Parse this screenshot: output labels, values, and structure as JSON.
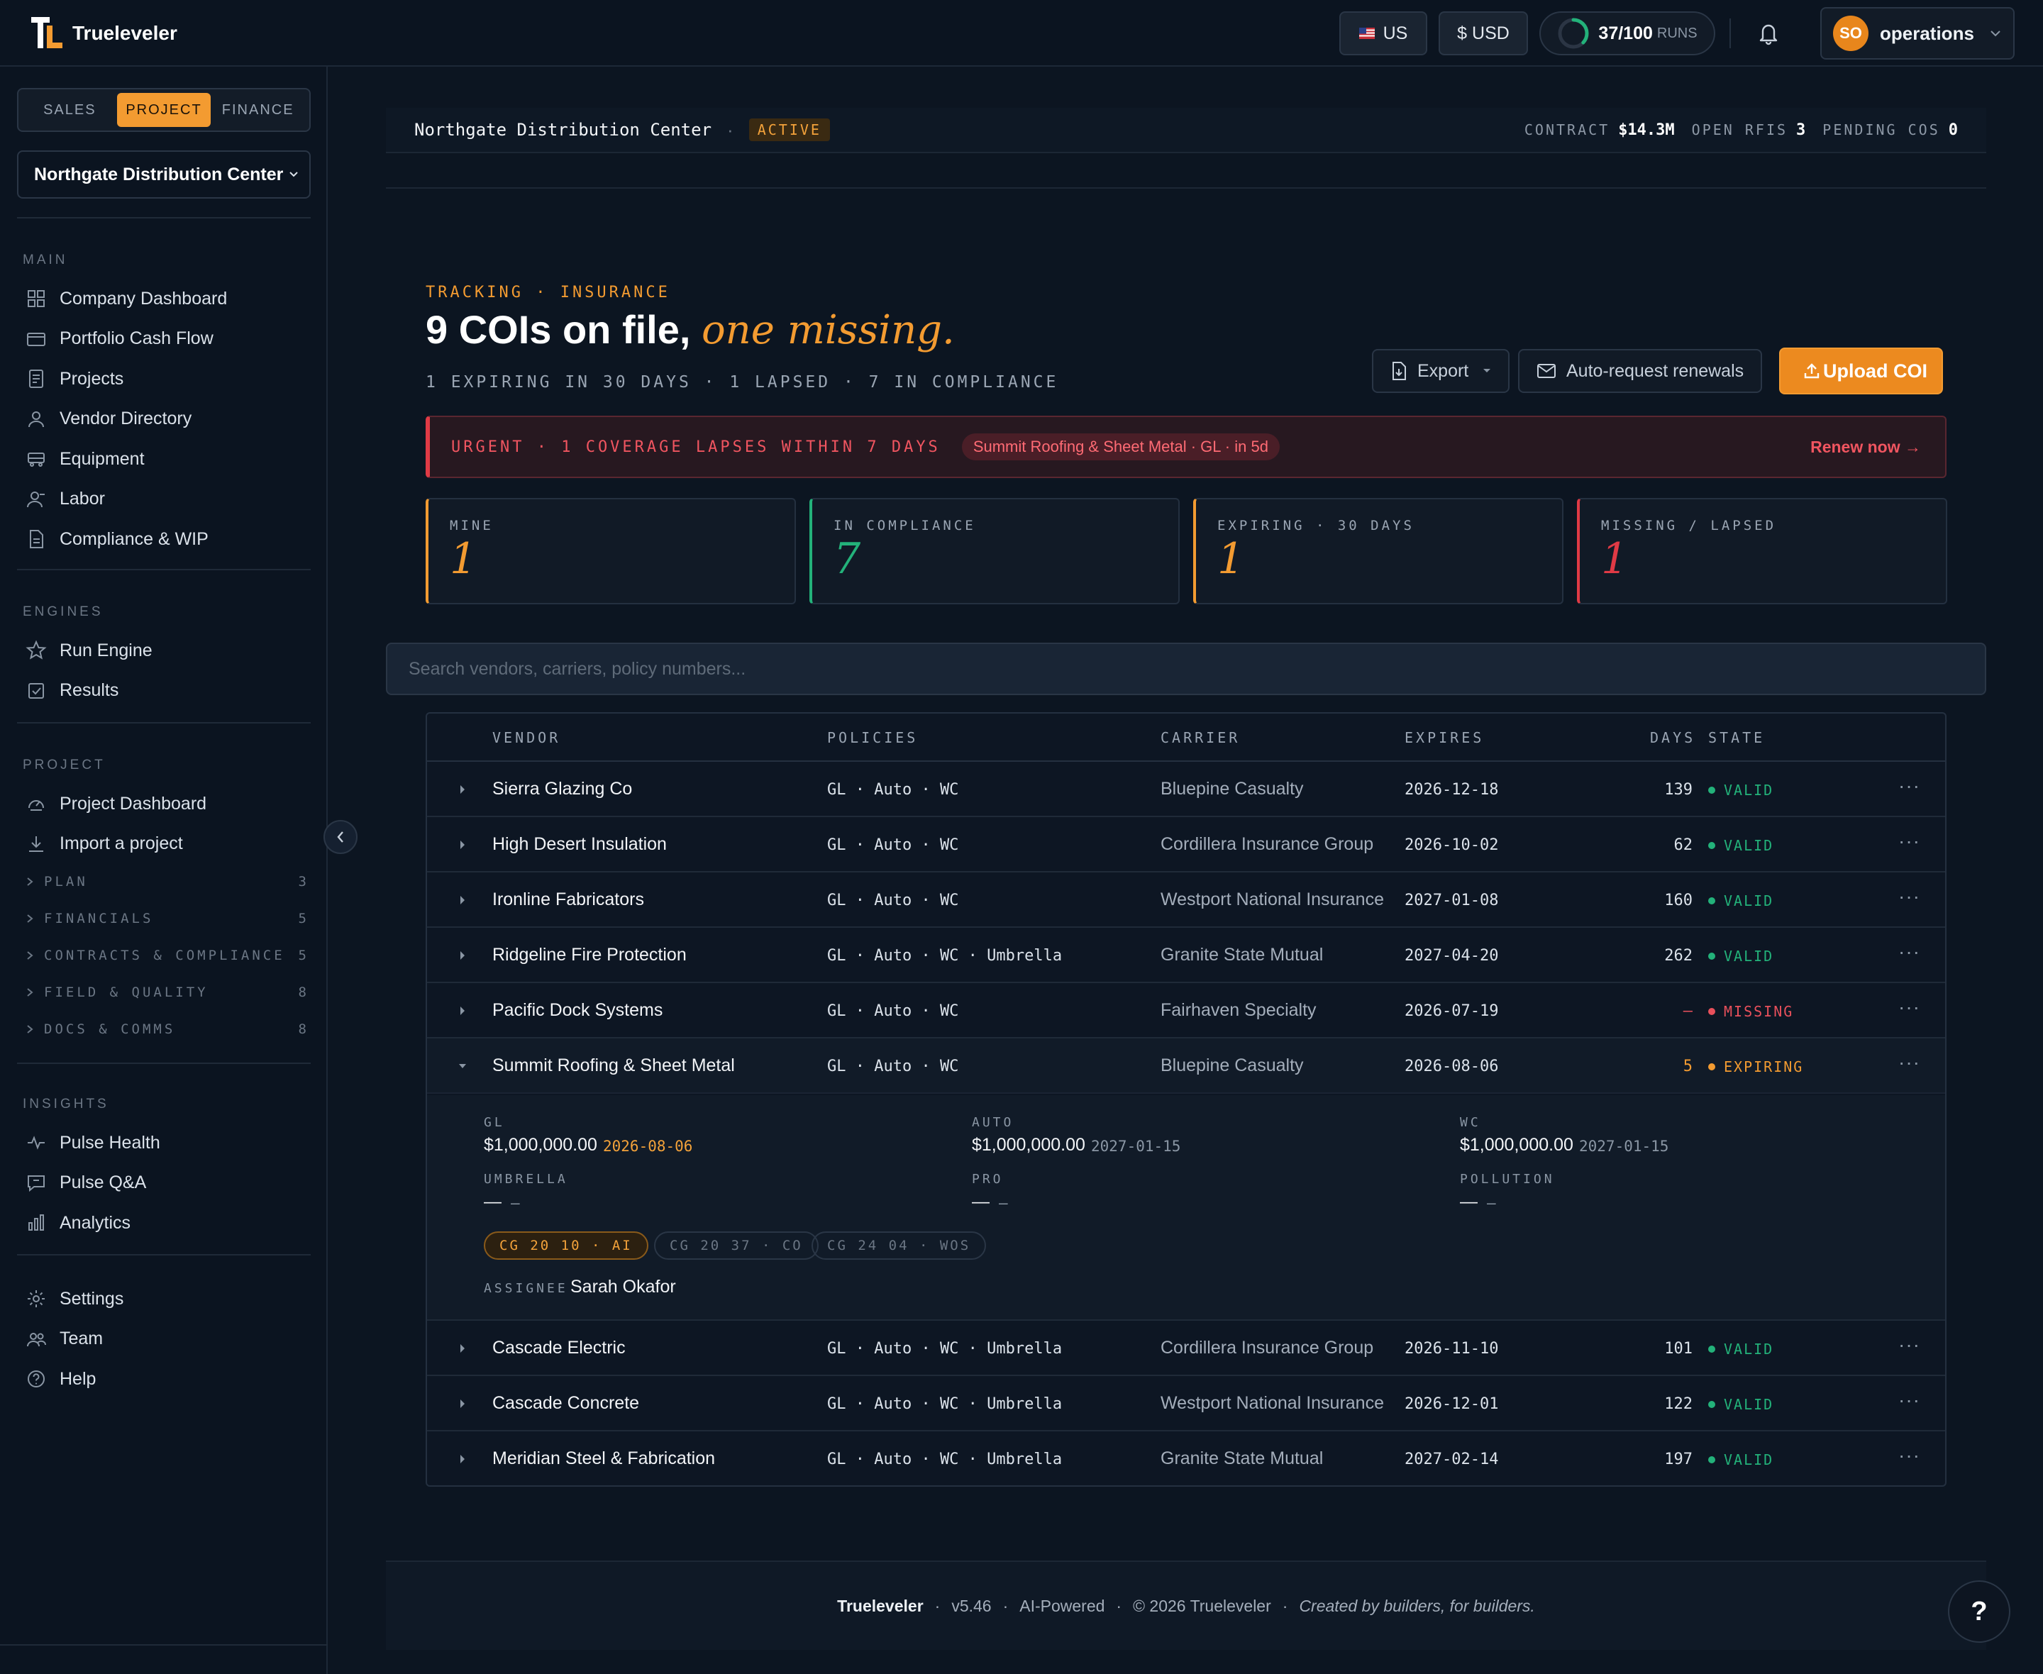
{
  "app": {
    "name": "Trueleveler"
  },
  "topbar": {
    "region": "US",
    "currency": "$ USD",
    "runs_used": "37/100",
    "runs_unit": "RUNS",
    "runs_fraction": 0.37,
    "user_initials": "SO",
    "user_name": "operations"
  },
  "sidebar": {
    "tabs": [
      "SALES",
      "PROJECT",
      "FINANCE"
    ],
    "active_tab": "PROJECT",
    "project": "Northgate Distribution Center",
    "main_heading": "MAIN",
    "main_items": [
      {
        "label": "Company Dashboard",
        "icon": "grid-icon"
      },
      {
        "label": "Portfolio Cash Flow",
        "icon": "wallet-icon"
      },
      {
        "label": "Projects",
        "icon": "document-icon"
      },
      {
        "label": "Vendor Directory",
        "icon": "person-icon"
      },
      {
        "label": "Equipment",
        "icon": "truck-icon"
      },
      {
        "label": "Labor",
        "icon": "worker-icon"
      },
      {
        "label": "Compliance & WIP",
        "icon": "file-icon"
      }
    ],
    "engines_heading": "ENGINES",
    "engine_items": [
      {
        "label": "Run Engine",
        "icon": "star-icon"
      },
      {
        "label": "Results",
        "icon": "checkbox-icon"
      }
    ],
    "project_heading": "PROJECT",
    "project_items": [
      {
        "label": "Project Dashboard",
        "icon": "gauge-icon"
      },
      {
        "label": "Import a project",
        "icon": "download-icon"
      }
    ],
    "groups": [
      {
        "label": "PLAN",
        "count": "3"
      },
      {
        "label": "FINANCIALS",
        "count": "5"
      },
      {
        "label": "CONTRACTS & COMPLIANCE",
        "count": "5"
      },
      {
        "label": "FIELD & QUALITY",
        "count": "8"
      },
      {
        "label": "DOCS & COMMS",
        "count": "8"
      }
    ],
    "insights_heading": "INSIGHTS",
    "insight_items": [
      {
        "label": "Pulse Health",
        "icon": "pulse-icon"
      },
      {
        "label": "Pulse Q&A",
        "icon": "chat-icon"
      },
      {
        "label": "Analytics",
        "icon": "bar-chart-icon"
      }
    ],
    "bottom_items": [
      {
        "label": "Settings",
        "icon": "gear-icon"
      },
      {
        "label": "Team",
        "icon": "team-icon"
      },
      {
        "label": "Help",
        "icon": "help-icon"
      }
    ]
  },
  "strip": {
    "project": "Northgate Distribution Center",
    "status": "ACTIVE",
    "contract_label": "CONTRACT",
    "contract_value": "$14.3M",
    "rfis_label": "OPEN RFIS",
    "rfis_value": "3",
    "cos_label": "PENDING COS",
    "cos_value": "0"
  },
  "header": {
    "eyebrow": "TRACKING · INSURANCE",
    "title_main": "9 COIs on file,",
    "title_accent": "one missing.",
    "subline": "1 EXPIRING IN 30 DAYS · 1 LAPSED · 7 IN COMPLIANCE",
    "export_label": "Export",
    "auto_label": "Auto-request renewals",
    "upload_label": "Upload COI"
  },
  "alert": {
    "text": "URGENT · 1 COVERAGE LAPSES WITHIN 7 DAYS",
    "chip": "Summit Roofing & Sheet Metal · GL · in 5d",
    "link": "Renew now →"
  },
  "cards": [
    {
      "label": "MINE",
      "value": "1",
      "color": "#f39b31"
    },
    {
      "label": "IN COMPLIANCE",
      "value": "7",
      "color": "#23b27a"
    },
    {
      "label": "EXPIRING · 30 DAYS",
      "value": "1",
      "color": "#f39b31"
    },
    {
      "label": "MISSING / LAPSED",
      "value": "1",
      "color": "#e03a45"
    }
  ],
  "search": {
    "placeholder": "Search vendors, carriers, policy numbers..."
  },
  "table": {
    "columns": [
      "VENDOR",
      "POLICIES",
      "CARRIER",
      "EXPIRES",
      "DAYS",
      "STATE"
    ],
    "rows": [
      {
        "vendor": "Sierra Glazing Co",
        "policies": "GL · Auto · WC",
        "carrier": "Bluepine Casualty",
        "expires": "2026-12-18",
        "days": "139",
        "state": "VALID"
      },
      {
        "vendor": "High Desert Insulation",
        "policies": "GL · Auto · WC",
        "carrier": "Cordillera Insurance Group",
        "expires": "2026-10-02",
        "days": "62",
        "state": "VALID"
      },
      {
        "vendor": "Ironline Fabricators",
        "policies": "GL · Auto · WC",
        "carrier": "Westport National Insurance",
        "expires": "2027-01-08",
        "days": "160",
        "state": "VALID"
      },
      {
        "vendor": "Ridgeline Fire Protection",
        "policies": "GL · Auto · WC · Umbrella",
        "carrier": "Granite State Mutual",
        "expires": "2027-04-20",
        "days": "262",
        "state": "VALID"
      },
      {
        "vendor": "Pacific Dock Systems",
        "policies": "GL · Auto · WC",
        "carrier": "Fairhaven Specialty",
        "expires": "2026-07-19",
        "days": "—",
        "state": "MISSING"
      },
      {
        "vendor": "Summit Roofing & Sheet Metal",
        "policies": "GL · Auto · WC",
        "carrier": "Bluepine Casualty",
        "expires": "2026-08-06",
        "days": "5",
        "state": "EXPIRING"
      },
      {
        "vendor": "Cascade Electric",
        "policies": "GL · Auto · WC · Umbrella",
        "carrier": "Cordillera Insurance Group",
        "expires": "2026-11-10",
        "days": "101",
        "state": "VALID"
      },
      {
        "vendor": "Cascade Concrete",
        "policies": "GL · Auto · WC · Umbrella",
        "carrier": "Westport National Insurance",
        "expires": "2026-12-01",
        "days": "122",
        "state": "VALID"
      },
      {
        "vendor": "Meridian Steel & Fabrication",
        "policies": "GL · Auto · WC · Umbrella",
        "carrier": "Granite State Mutual",
        "expires": "2027-02-14",
        "days": "197",
        "state": "VALID"
      }
    ],
    "state_colors": {
      "VALID": "#23b27a",
      "MISSING": "#e8505b",
      "EXPIRING": "#f39b31"
    },
    "expanded": {
      "coverages": [
        {
          "label": "GL",
          "amount": "$1,000,000.00",
          "date": "2026-08-06",
          "warn": true
        },
        {
          "label": "AUTO",
          "amount": "$1,000,000.00",
          "date": "2027-01-15",
          "warn": false
        },
        {
          "label": "WC",
          "amount": "$1,000,000.00",
          "date": "2027-01-15",
          "warn": false
        },
        {
          "label": "UMBRELLA",
          "amount": "—",
          "date": "—",
          "warn": false
        },
        {
          "label": "PRO",
          "amount": "—",
          "date": "—",
          "warn": false
        },
        {
          "label": "POLLUTION",
          "amount": "—",
          "date": "—",
          "warn": false
        }
      ],
      "endorsements": [
        {
          "label": "CG 20 10 · AI",
          "present": true
        },
        {
          "label": "CG 20 37 · CO",
          "present": false
        },
        {
          "label": "CG 24 04 · WOS",
          "present": false
        }
      ],
      "assignee_label": "ASSIGNEE",
      "assignee": "Sarah Okafor"
    }
  },
  "footer": {
    "brand": "Trueleveler",
    "version": "v5.46",
    "tag": "AI-Powered",
    "copyright": "© 2026 Trueleveler",
    "motto": "Created by builders, for builders."
  },
  "help_button": "?"
}
